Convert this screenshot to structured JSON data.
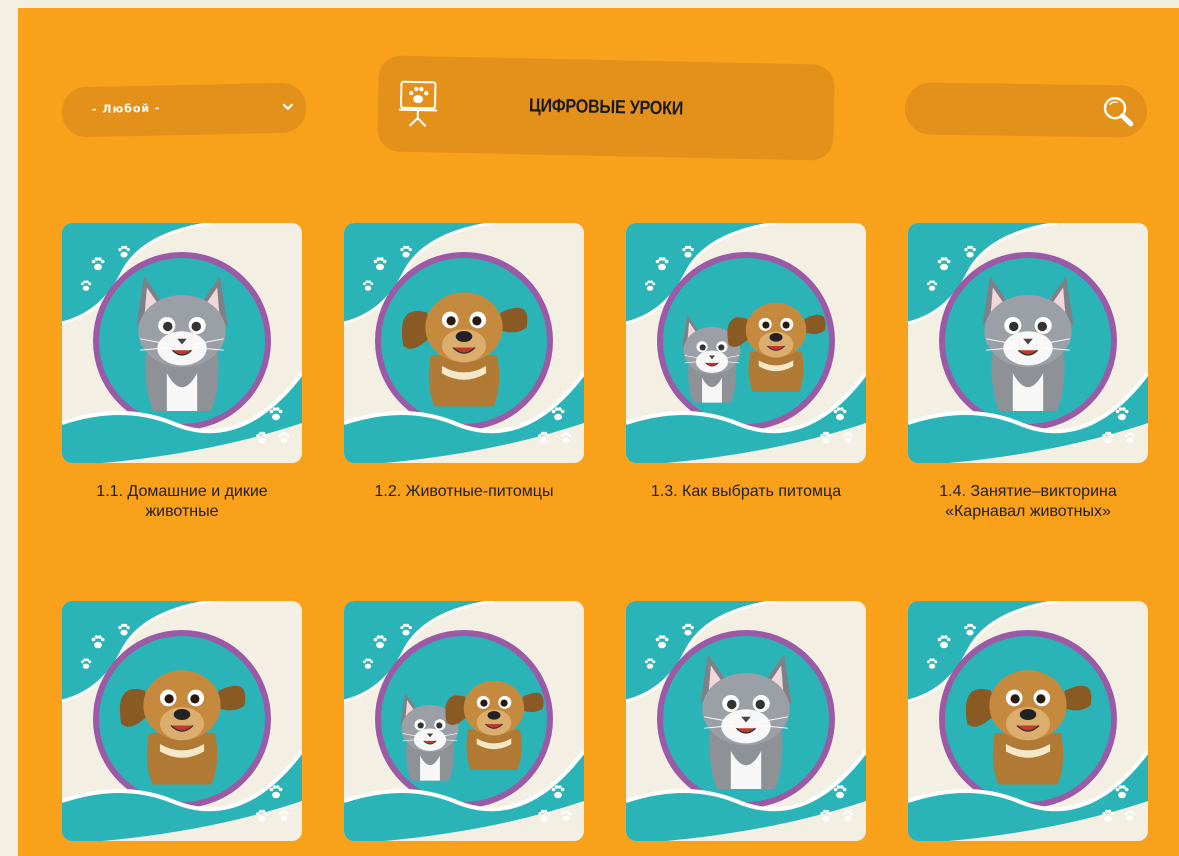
{
  "filter": {
    "selected": "- Любой -"
  },
  "header": {
    "title": "ЦИФРОВЫЕ УРОКИ"
  },
  "search": {
    "placeholder": ""
  },
  "lessons": [
    {
      "title": "1.1. Домашние и дикие животные",
      "animals": [
        "cat"
      ]
    },
    {
      "title": "1.2. Животные-питомцы",
      "animals": [
        "dog"
      ]
    },
    {
      "title": "1.3. Как выбрать питомца",
      "animals": [
        "cat",
        "dog"
      ]
    },
    {
      "title": "1.4. Занятие–викторина «Карнавал животных»",
      "animals": [
        "cat"
      ]
    },
    {
      "title": "",
      "animals": [
        "dog"
      ]
    },
    {
      "title": "",
      "animals": [
        "cat",
        "dog"
      ]
    },
    {
      "title": "",
      "animals": [
        "cat"
      ]
    },
    {
      "title": "",
      "animals": [
        "dog"
      ]
    }
  ],
  "colors": {
    "background": "#f9a11b",
    "control": "#e3911b",
    "teal": "#2bb4b8",
    "ring": "#9b59a6",
    "cream": "#f4efe3"
  }
}
